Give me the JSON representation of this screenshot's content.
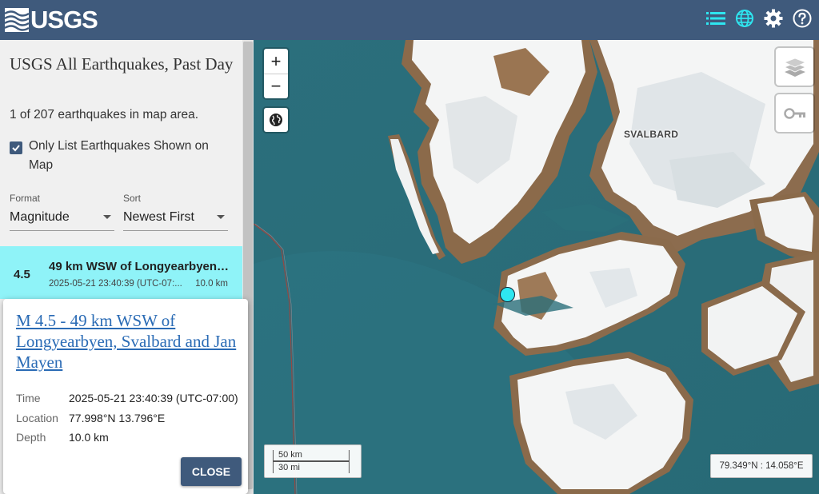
{
  "header": {
    "logo_text": "USGS",
    "icons": [
      "list-icon",
      "globe-icon",
      "gear-icon",
      "help-icon"
    ],
    "colors": {
      "bar": "#3f5a7c",
      "active_icon": "#2ee6f0"
    }
  },
  "sidebar": {
    "title": "USGS All Earthquakes, Past Day",
    "count_text": "1 of 207 earthquakes in map area.",
    "only_list_label": "Only List Earthquakes Shown on Map",
    "only_list_checked": true,
    "format": {
      "caption": "Format",
      "value": "Magnitude"
    },
    "sort": {
      "caption": "Sort",
      "value": "Newest First"
    },
    "earthquakes": [
      {
        "mag": "4.5",
        "place": "49 km WSW of Longyearbyen, Svalbard and Jan Mayen",
        "time": "2025-05-21 23:40:39 (UTC-07:...",
        "depth": "10.0 km"
      }
    ],
    "highlight_color": "#8ff3f8"
  },
  "map": {
    "region_label": "SVALBARD",
    "scale": {
      "km": "50 km",
      "mi": "30 mi"
    },
    "cursor_coords": "79.349°N : 14.058°E",
    "controls": {
      "zoom_in": "+",
      "zoom_out": "−"
    }
  },
  "popup": {
    "title": "M 4.5 - 49 km WSW of Longyearbyen, Svalbard and Jan Mayen",
    "props": [
      {
        "key": "Time",
        "value": "2025-05-21 23:40:39 (UTC-07:00)"
      },
      {
        "key": "Location",
        "value": "77.998°N 13.796°E"
      },
      {
        "key": "Depth",
        "value": "10.0 km"
      }
    ],
    "close_label": "CLOSE"
  }
}
